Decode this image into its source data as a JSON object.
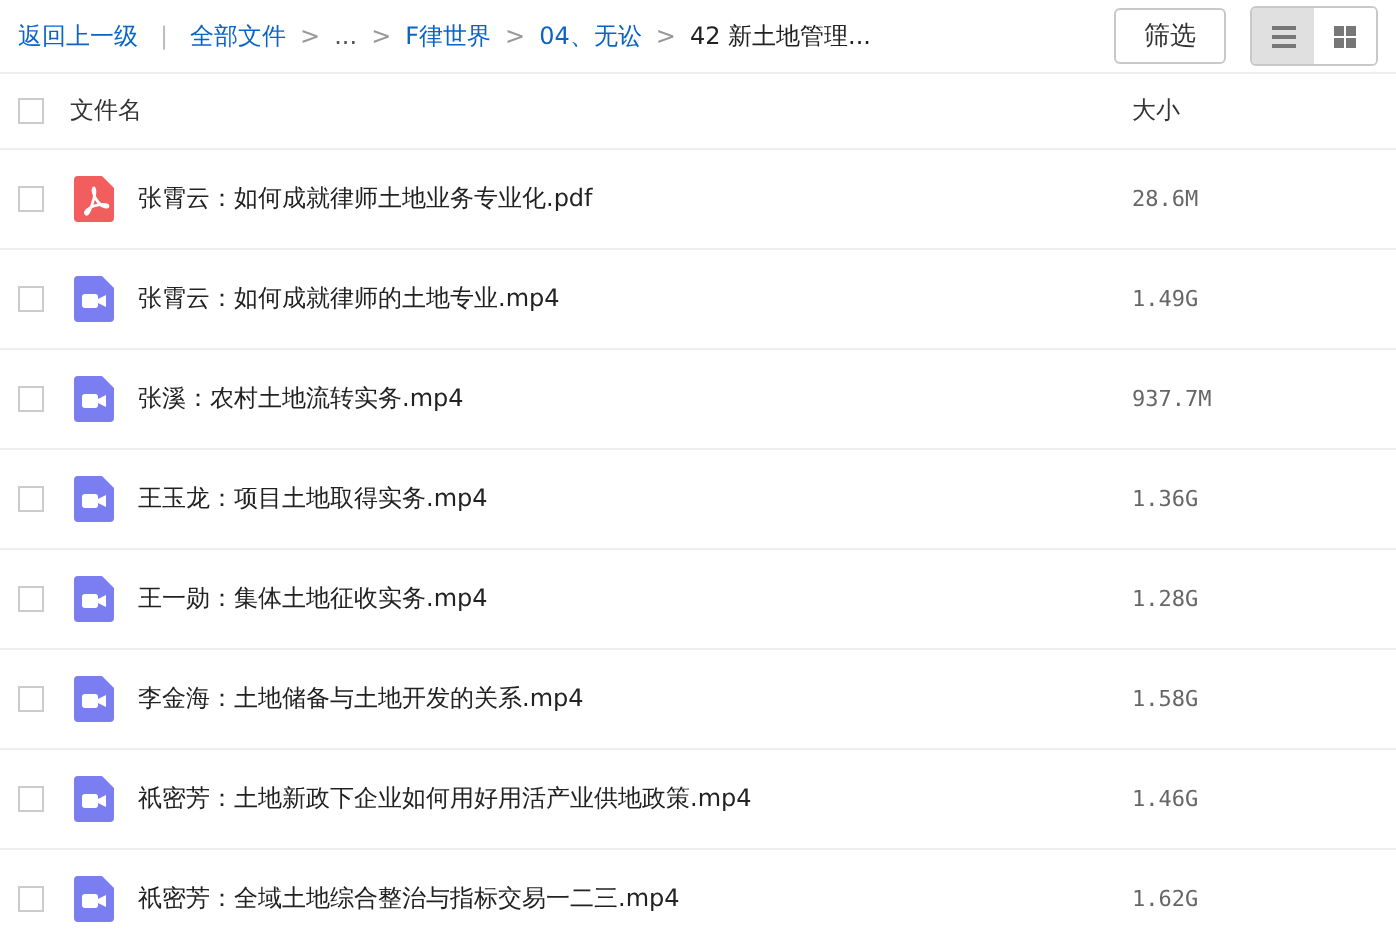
{
  "breadcrumb": [
    {
      "kind": "link",
      "text": "返回上一级"
    },
    {
      "kind": "divider",
      "text": "|"
    },
    {
      "kind": "link",
      "text": "全部文件"
    },
    {
      "kind": "sep",
      "text": ">"
    },
    {
      "kind": "plain",
      "text": "..."
    },
    {
      "kind": "sep",
      "text": ">"
    },
    {
      "kind": "link",
      "text": "F律世界"
    },
    {
      "kind": "sep",
      "text": ">"
    },
    {
      "kind": "link",
      "text": "04、无讼"
    },
    {
      "kind": "sep",
      "text": ">"
    },
    {
      "kind": "current",
      "text": "42 新土地管理..."
    }
  ],
  "filter_button": "筛选",
  "view_modes": [
    {
      "kind": "list",
      "selected": true
    },
    {
      "kind": "grid",
      "selected": false
    }
  ],
  "table": {
    "select_all": {
      "checked": false
    },
    "columns": [
      "文件名",
      "大小"
    ],
    "rows": [
      {
        "kind": "pdf",
        "name": "张霄云：如何成就律师土地业务专业化.pdf",
        "size": "28.6M",
        "checked": false
      },
      {
        "kind": "video",
        "name": "张霄云：如何成就律师的土地专业.mp4",
        "size": "1.49G",
        "checked": false
      },
      {
        "kind": "video",
        "name": "张溪：农村土地流转实务.mp4",
        "size": "937.7M",
        "checked": false
      },
      {
        "kind": "video",
        "name": "王玉龙：项目土地取得实务.mp4",
        "size": "1.36G",
        "checked": false
      },
      {
        "kind": "video",
        "name": "王一勋：集体土地征收实务.mp4",
        "size": "1.28G",
        "checked": false
      },
      {
        "kind": "video",
        "name": "李金海：土地储备与土地开发的关系.mp4",
        "size": "1.58G",
        "checked": false
      },
      {
        "kind": "video",
        "name": "祇密芳：土地新政下企业如何用好用活产业供地政策.mp4",
        "size": "1.46G",
        "checked": false
      },
      {
        "kind": "video",
        "name": "祇密芳：全域土地综合整治与指标交易一二三.mp4",
        "size": "1.62G",
        "checked": false
      }
    ]
  }
}
